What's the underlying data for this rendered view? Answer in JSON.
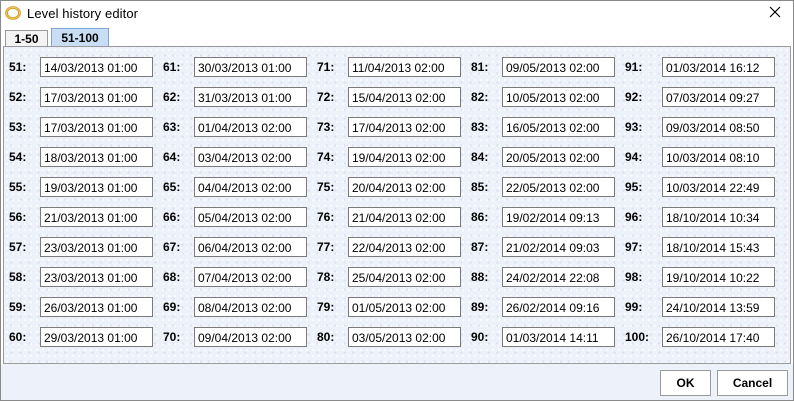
{
  "window": {
    "title": "Level history editor"
  },
  "tabs": [
    {
      "label": "1-50",
      "selected": false
    },
    {
      "label": "51-100",
      "selected": true
    }
  ],
  "entries": [
    {
      "label": "51:",
      "value": "14/03/2013 01:00"
    },
    {
      "label": "52:",
      "value": "17/03/2013 01:00"
    },
    {
      "label": "53:",
      "value": "17/03/2013 01:00"
    },
    {
      "label": "54:",
      "value": "18/03/2013 01:00"
    },
    {
      "label": "55:",
      "value": "19/03/2013 01:00"
    },
    {
      "label": "56:",
      "value": "21/03/2013 01:00"
    },
    {
      "label": "57:",
      "value": "23/03/2013 01:00"
    },
    {
      "label": "58:",
      "value": "23/03/2013 01:00"
    },
    {
      "label": "59:",
      "value": "26/03/2013 01:00"
    },
    {
      "label": "60:",
      "value": "29/03/2013 01:00"
    },
    {
      "label": "61:",
      "value": "30/03/2013 01:00"
    },
    {
      "label": "62:",
      "value": "31/03/2013 01:00"
    },
    {
      "label": "63:",
      "value": "01/04/2013 02:00"
    },
    {
      "label": "64:",
      "value": "03/04/2013 02:00"
    },
    {
      "label": "65:",
      "value": "04/04/2013 02:00"
    },
    {
      "label": "66:",
      "value": "05/04/2013 02:00"
    },
    {
      "label": "67:",
      "value": "06/04/2013 02:00"
    },
    {
      "label": "68:",
      "value": "07/04/2013 02:00"
    },
    {
      "label": "69:",
      "value": "08/04/2013 02:00"
    },
    {
      "label": "70:",
      "value": "09/04/2013 02:00"
    },
    {
      "label": "71:",
      "value": "11/04/2013 02:00"
    },
    {
      "label": "72:",
      "value": "15/04/2013 02:00"
    },
    {
      "label": "73:",
      "value": "17/04/2013 02:00"
    },
    {
      "label": "74:",
      "value": "19/04/2013 02:00"
    },
    {
      "label": "75:",
      "value": "20/04/2013 02:00"
    },
    {
      "label": "76:",
      "value": "21/04/2013 02:00"
    },
    {
      "label": "77:",
      "value": "22/04/2013 02:00"
    },
    {
      "label": "78:",
      "value": "25/04/2013 02:00"
    },
    {
      "label": "79:",
      "value": "01/05/2013 02:00"
    },
    {
      "label": "80:",
      "value": "03/05/2013 02:00"
    },
    {
      "label": "81:",
      "value": "09/05/2013 02:00"
    },
    {
      "label": "82:",
      "value": "10/05/2013 02:00"
    },
    {
      "label": "83:",
      "value": "16/05/2013 02:00"
    },
    {
      "label": "84:",
      "value": "20/05/2013 02:00"
    },
    {
      "label": "85:",
      "value": "22/05/2013 02:00"
    },
    {
      "label": "86:",
      "value": "19/02/2014 09:13"
    },
    {
      "label": "87:",
      "value": "21/02/2014 09:03"
    },
    {
      "label": "88:",
      "value": "24/02/2014 22:08"
    },
    {
      "label": "89:",
      "value": "26/02/2014 09:16"
    },
    {
      "label": "90:",
      "value": "01/03/2014 14:11"
    },
    {
      "label": "91:",
      "value": "01/03/2014 16:12"
    },
    {
      "label": "92:",
      "value": "07/03/2014 09:27"
    },
    {
      "label": "93:",
      "value": "09/03/2014 08:50"
    },
    {
      "label": "94:",
      "value": "10/03/2014 08:10"
    },
    {
      "label": "95:",
      "value": "10/03/2014 22:49"
    },
    {
      "label": "96:",
      "value": "18/10/2014 10:34"
    },
    {
      "label": "97:",
      "value": "18/10/2014 15:43"
    },
    {
      "label": "98:",
      "value": "19/10/2014 10:22"
    },
    {
      "label": "99:",
      "value": "24/10/2014 13:59"
    },
    {
      "label": "100:",
      "value": "26/10/2014 17:40"
    }
  ],
  "buttons": {
    "ok_label": "OK",
    "cancel_label": "Cancel"
  },
  "icons": {
    "app": "ring-logo-icon",
    "close": "close-icon"
  },
  "colors": {
    "selected_tab": "#c9def5",
    "panel_background": "#edf1fa",
    "window_border": "#8a8a8a"
  }
}
